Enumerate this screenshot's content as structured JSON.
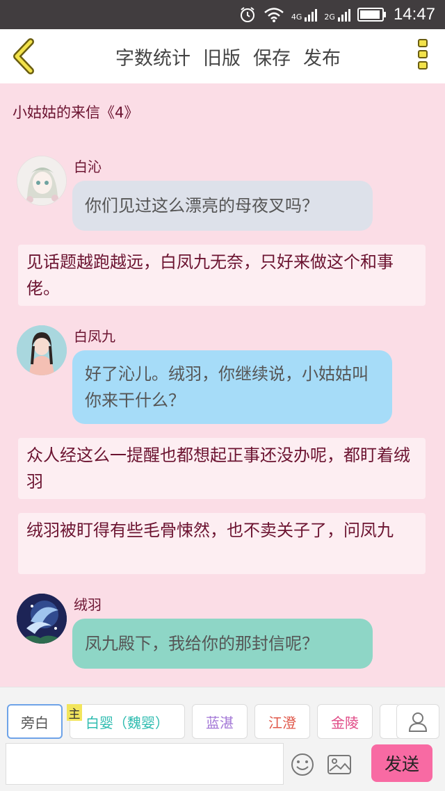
{
  "status_bar": {
    "time": "14:47",
    "net1": "4G",
    "net2": "2G",
    "icons": [
      "alarm-icon",
      "wifi-icon",
      "signal-icon",
      "battery-icon"
    ]
  },
  "toolbar": {
    "back_icon": "chevron-left-icon",
    "menu": [
      {
        "label": "字数统计"
      },
      {
        "label": "旧版"
      },
      {
        "label": "保存"
      },
      {
        "label": "发布"
      }
    ],
    "more_icon": "more-vertical-icon"
  },
  "chapter": {
    "title": "小姑姑的来信《4》"
  },
  "messages": [
    {
      "kind": "dialog",
      "speaker": "白沁",
      "text": "你们见过这么漂亮的母夜叉吗？",
      "bubble_color": "#dde1ea"
    },
    {
      "kind": "narration",
      "text": "见话题越跑越远，白凤九无奈，只好来做这个和事佬。"
    },
    {
      "kind": "dialog",
      "speaker": "白凤九",
      "text": "好了沁儿。绒羽，你继续说，小姑姑叫你来干什么？",
      "bubble_color": "#a6dcf8"
    },
    {
      "kind": "narration",
      "text": "众人经这么一提醒也都想起正事还没办呢，都盯着绒羽"
    },
    {
      "kind": "narration",
      "text": "绒羽被盯得有些毛骨悚然，也不卖关子了，问凤九"
    },
    {
      "kind": "dialog",
      "speaker": "绒羽",
      "text": "凤九殿下，我给你的那封信呢？",
      "bubble_color": "#8ed6c6"
    }
  ],
  "characters": {
    "main_tag": "主",
    "chips": [
      {
        "label": "旁白",
        "color": "#555555"
      },
      {
        "label": "白婴（魏婴）",
        "color": "#2fbcb0"
      },
      {
        "label": "蓝湛",
        "color": "#a276d6"
      },
      {
        "label": "江澄",
        "color": "#e0584a"
      },
      {
        "label": "金陵",
        "color": "#e04a86"
      }
    ],
    "user_icon": "user-icon"
  },
  "input": {
    "placeholder": "",
    "value": "",
    "emoji_icon": "smiley-icon",
    "image_icon": "image-icon",
    "send_label": "发送"
  }
}
